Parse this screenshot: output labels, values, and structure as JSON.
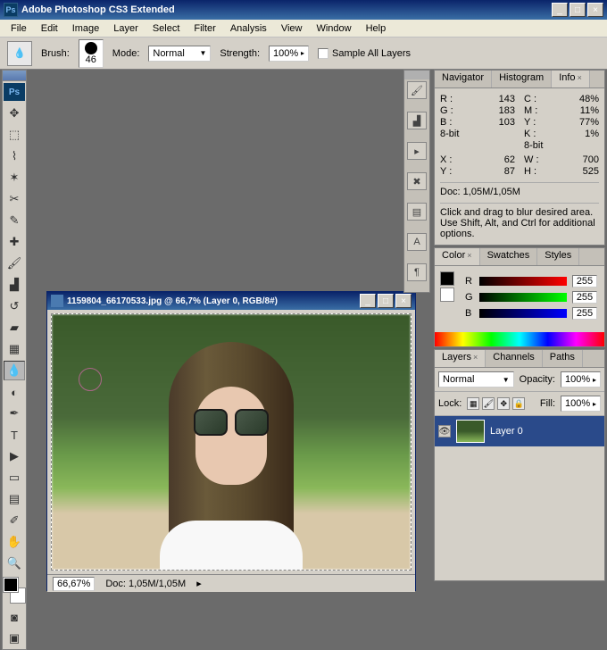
{
  "app": {
    "title": "Adobe Photoshop CS3 Extended"
  },
  "menu": [
    "File",
    "Edit",
    "Image",
    "Layer",
    "Select",
    "Filter",
    "Analysis",
    "View",
    "Window",
    "Help"
  ],
  "options": {
    "brush_label": "Brush:",
    "brush_size": "46",
    "mode_label": "Mode:",
    "mode_value": "Normal",
    "strength_label": "Strength:",
    "strength_value": "100%",
    "sample_all_label": "Sample All Layers"
  },
  "document": {
    "title": "1159804_66170533.jpg @ 66,7% (Layer 0, RGB/8#)",
    "zoom": "66,67%",
    "doc_size": "Doc: 1,05M/1,05M"
  },
  "panels": {
    "nav_tabs": {
      "navigator": "Navigator",
      "histogram": "Histogram",
      "info": "Info"
    },
    "info": {
      "R": "143",
      "G": "183",
      "B": "103",
      "C": "48%",
      "M": "11%",
      "Y": "77%",
      "K": "1%",
      "depth": "8-bit",
      "depth2": "8-bit",
      "X": "62",
      "Yc": "87",
      "W": "700",
      "H": "525",
      "doc": "Doc: 1,05M/1,05M",
      "hint": "Click and drag to blur desired area. Use Shift, Alt, and Ctrl for additional options."
    },
    "color_tabs": {
      "color": "Color",
      "swatches": "Swatches",
      "styles": "Styles"
    },
    "color": {
      "R": "255",
      "G": "255",
      "B": "255"
    },
    "layer_tabs": {
      "layers": "Layers",
      "channels": "Channels",
      "paths": "Paths"
    },
    "layers": {
      "blend": "Normal",
      "opacity_label": "Opacity:",
      "opacity": "100%",
      "lock_label": "Lock:",
      "fill_label": "Fill:",
      "fill": "100%",
      "layer0": "Layer 0"
    }
  }
}
